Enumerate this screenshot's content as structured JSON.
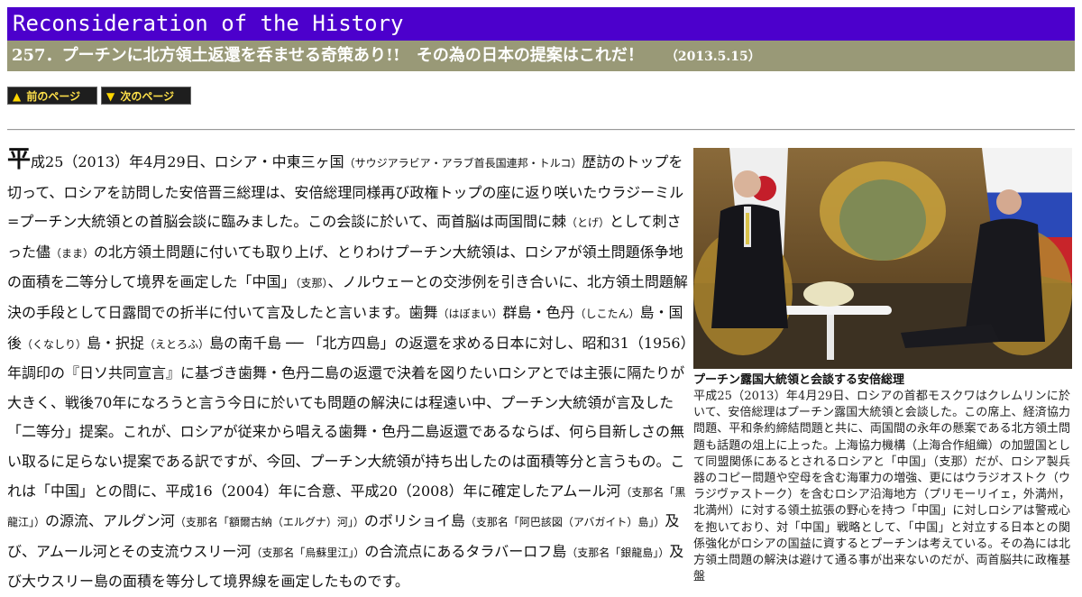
{
  "site": {
    "title": "Reconsideration of the History"
  },
  "article": {
    "title": "257．プーチンに北方領土返還を呑ませる奇策あり!!　その為の日本の提案はこれだ！",
    "date": "（2013.5.15）"
  },
  "nav": {
    "prev_label": "前のページ",
    "next_label": "次のページ",
    "prev_icon": "triangle-up-icon",
    "next_icon": "triangle-down-icon"
  },
  "body": {
    "drop_cap": "平",
    "runs": [
      {
        "t": "成25（2013）年4月29日、ロシア・中東三ヶ国"
      },
      {
        "t": "（サウジアラビア・アラブ首長国連邦・トルコ）",
        "small": true
      },
      {
        "t": "歴訪のトップを切って、ロシアを訪問した安倍晋三総理は、安倍総理同様再び政権トップの座に返り咲いたウラジーミル=プーチン大統領との首脳会談に臨みました。この会談に於いて、両首脳は両国間に棘"
      },
      {
        "t": "（とげ）",
        "small": true
      },
      {
        "t": "として刺さった儘"
      },
      {
        "t": "（まま）",
        "small": true
      },
      {
        "t": "の北方領土問題に付いても取り上げ、とりわけプーチン大統領は、ロシアが領土問題係争地の面積を二等分して境界を画定した「中国」"
      },
      {
        "t": "（支那）",
        "small": true
      },
      {
        "t": "、ノルウェーとの交渉例を引き合いに、北方領土問題解決の手段として日露間での折半に付いて言及したと言います。歯舞"
      },
      {
        "t": "（はぼまい）",
        "small": true
      },
      {
        "t": "群島・色丹"
      },
      {
        "t": "（しこたん）",
        "small": true
      },
      {
        "t": "島・国後"
      },
      {
        "t": "（くなしり）",
        "small": true
      },
      {
        "t": "島・択捉"
      },
      {
        "t": "（えとろふ）",
        "small": true
      },
      {
        "t": "島の南千島 ── 「北方四島」の返還を求める日本に対し、昭和31（1956）年調印の『日ソ共同宣言』に基づき歯舞・色丹二島の返還で決着を図りたいロシアとでは主張に隔たりが大きく、戦後70年になろうと言う今日に於いても問題の解決には程遠い中、プーチン大統領が言及した「二等分」提案。これが、ロシアが従来から唱える歯舞・色丹二島返還であるならば、何ら目新しさの無い取るに足らない提案である訳ですが、今回、プーチン大統領が持ち出したのは面積等分と言うもの。これは「中国」との間に、平成16（2004）年に合意、平成20（2008）年に確定したアムール河"
      },
      {
        "t": "（支那名「黒龍江」）",
        "small": true
      },
      {
        "t": "の源流、アルグン河"
      },
      {
        "t": "（支那名「額爾古納（エルグナ）河」）",
        "small": true
      },
      {
        "t": "のボリショイ島"
      },
      {
        "t": "（支那名「阿巴該図（アバガイト）島」）",
        "small": true
      },
      {
        "t": "及び、アムール河とその支流ウスリー河"
      },
      {
        "t": "（支那名「烏蘇里江」）",
        "small": true
      },
      {
        "t": "の合流点にあるタラバーロフ島"
      },
      {
        "t": "（支那名「銀龍島」）",
        "small": true
      },
      {
        "t": "及び大ウスリー島の面積を等分して境界線を画定したものです。"
      }
    ]
  },
  "photo": {
    "caption_title": "プーチン露国大統領と会談する安倍総理",
    "caption_text": "平成25（2013）年4月29日、ロシアの首都モスクワはクレムリンに於いて、安倍総理はプーチン露国大統領と会談した。この席上、経済協力問題、平和条約締結問題と共に、両国間の永年の懸案である北方領土問題も話題の俎上に上った。上海協力機構（上海合作組織）の加盟国として同盟関係にあるとされるロシアと「中国」（支那）だが、ロシア製兵器のコピー問題や空母を含む海軍力の増強、更にはウラジオストク（ウラジヴァストーク）を含むロシア沿海地方（プリモーリイェ，外満州，北満州）に対する領土拡張の野心を持つ「中国」に対しロシアは警戒心を抱いており、対「中国」戦略として、「中国」と対立する日本との関係強化がロシアの国益に資するとプーチンは考えている。その為には北方領土問題の解決は避けて通る事が出来ないのだが、両首脳共に政権基盤"
  },
  "colors": {
    "banner": "#4c00cc",
    "title_bar": "#999977",
    "button_bg": "#1e1e1e",
    "button_text": "#ffe14a"
  }
}
